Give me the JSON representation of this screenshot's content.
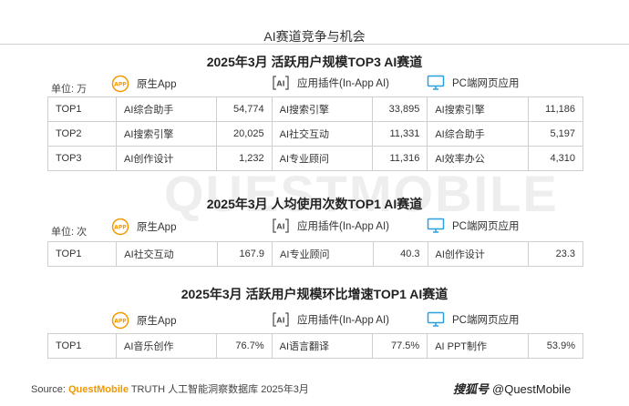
{
  "page_title": "AI赛道竞争与机会",
  "watermark": "QUESTMOBILE",
  "legend": {
    "native_app": "原生App",
    "in_app": "应用插件(In-App AI)",
    "pc_web": "PC端网页应用",
    "app_icon_text": "APP",
    "ai_icon_text": "AI"
  },
  "sections": [
    {
      "title": "2025年3月 活跃用户规模TOP3 AI赛道",
      "unit": "单位: 万",
      "rows": [
        {
          "rank": "TOP1",
          "native_name": "AI综合助手",
          "native_value": "54,774",
          "inapp_name": "AI搜索引擎",
          "inapp_value": "33,895",
          "pc_name": "AI搜索引擎",
          "pc_value": "11,186"
        },
        {
          "rank": "TOP2",
          "native_name": "AI搜索引擎",
          "native_value": "20,025",
          "inapp_name": "AI社交互动",
          "inapp_value": "11,331",
          "pc_name": "AI综合助手",
          "pc_value": "5,197"
        },
        {
          "rank": "TOP3",
          "native_name": "AI创作设计",
          "native_value": "1,232",
          "inapp_name": "AI专业顾问",
          "inapp_value": "11,316",
          "pc_name": "AI效率办公",
          "pc_value": "4,310"
        }
      ]
    },
    {
      "title": "2025年3月 人均使用次数TOP1 AI赛道",
      "unit": "单位: 次",
      "rows": [
        {
          "rank": "TOP1",
          "native_name": "AI社交互动",
          "native_value": "167.9",
          "inapp_name": "AI专业顾问",
          "inapp_value": "40.3",
          "pc_name": "AI创作设计",
          "pc_value": "23.3"
        }
      ]
    },
    {
      "title": "2025年3月 活跃用户规模环比增速TOP1 AI赛道",
      "unit": "",
      "rows": [
        {
          "rank": "TOP1",
          "native_name": "AI音乐创作",
          "native_value": "76.7%",
          "inapp_name": "AI语言翻译",
          "inapp_value": "77.5%",
          "pc_name": "AI PPT制作",
          "pc_value": "53.9%"
        }
      ]
    }
  ],
  "footer": {
    "prefix": "Source: ",
    "brand": "QuestMobile",
    "rest": " TRUTH 人工智能洞察数据库 2025年3月"
  },
  "credit": {
    "source": "搜狐号",
    "handle": "@QuestMobile"
  },
  "colors": {
    "app_orange": "#f39800",
    "pc_blue": "#2aa0e0",
    "border": "#cfcfcf"
  }
}
